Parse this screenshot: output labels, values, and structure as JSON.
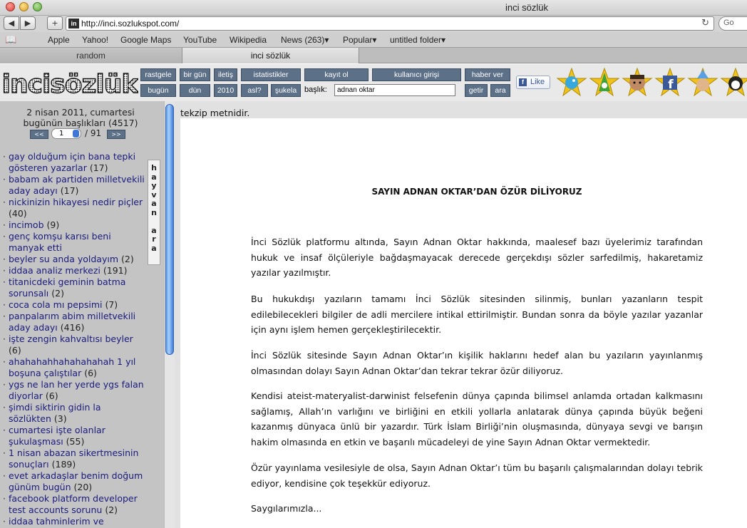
{
  "window": {
    "title": "inci sözlük"
  },
  "toolbar": {
    "back_icon": "back-arrow-icon",
    "forward_icon": "forward-arrow-icon",
    "add_icon": "plus-icon",
    "favicon_text": "in",
    "url": "http://inci.sozlukspot.com/",
    "reload_icon": "reload-icon",
    "search_placeholder": "Go"
  },
  "bookmarks": {
    "items": [
      "Apple",
      "Yahoo!",
      "Google Maps",
      "YouTube",
      "Wikipedia",
      "News (263)▾",
      "Popular▾",
      "untitled folder▾"
    ]
  },
  "tabs": [
    {
      "label": "random"
    },
    {
      "label": "inci sözlük"
    }
  ],
  "header": {
    "nav_row1": [
      "rastgele",
      "bir gün",
      "iletiş",
      "istatistikler",
      "kayıt ol",
      "kullanıcı girişi",
      "haber ver"
    ],
    "nav_row2": [
      "bugün",
      "dün",
      "2010",
      "asl?",
      "şukela",
      "getir",
      "ara"
    ],
    "baslik_label": "başlık:",
    "baslik_value": "adnan oktar",
    "like_label": "Like",
    "like_icon": "facebook-f-icon"
  },
  "left": {
    "date": "2 nisan 2011, cumartesi",
    "today_count": "bugünün başlıkları (4517)",
    "pager": {
      "prev": "<<",
      "next": ">>",
      "page": "1",
      "total": "/ 91"
    },
    "vertical_tab": [
      "h",
      "a",
      "y",
      "v",
      "a",
      "n",
      "",
      "a",
      "r",
      "a"
    ],
    "topics": [
      {
        "title": "gay olduğum için bana tepki gösteren yazarlar",
        "count": "(17)"
      },
      {
        "title": "babam ak partiden milletvekili aday adayı",
        "count": "(17)"
      },
      {
        "title": "nickinizin hikayesi nedir piçler",
        "count": "(40)"
      },
      {
        "title": "incimob",
        "count": "(9)"
      },
      {
        "title": "genç komşu karısı beni manyak etti",
        "count": ""
      },
      {
        "title": "beyler su anda yoldayım",
        "count": "(2)"
      },
      {
        "title": "iddaa analiz merkezi",
        "count": "(191)"
      },
      {
        "title": "titanicdeki geminin batma sorunsalı",
        "count": "(2)"
      },
      {
        "title": "coca cola mı pepsimi",
        "count": "(7)"
      },
      {
        "title": "panpalarım abim milletvekili aday adayı",
        "count": "(416)"
      },
      {
        "title": "işte zengin kahvaltısı beyler",
        "count": "(6)"
      },
      {
        "title": "ahahahahhahahahahah 1 yıl boşuna çalıştılar",
        "count": "(6)"
      },
      {
        "title": "ygs ne lan her yerde ygs falan diyorlar",
        "count": "(6)"
      },
      {
        "title": "şimdi siktirin gidin la sözlükten",
        "count": "(3)"
      },
      {
        "title": "cumartesi işte olanlar şukulaşması",
        "count": "(55)"
      },
      {
        "title": "1 nisan abazan sikertmesinin sonuçları",
        "count": "(189)"
      },
      {
        "title": "evet arkadaşlar benim doğum günüm bugün",
        "count": "(20)"
      },
      {
        "title": "facebook platform developer test accounts sorunu",
        "count": "(2)"
      },
      {
        "title": "iddaa tahminlerim ve",
        "count": ""
      }
    ]
  },
  "main": {
    "notice": "tekzip metnidir.",
    "title": "SAYIN ADNAN OKTAR’DAN ÖZÜR DİLİYORUZ",
    "paragraphs": [
      "İnci Sözlük platformu altında, Sayın Adnan Oktar hakkında, maalesef bazı üyelerimiz tarafından hukuk ve insaf ölçüleriyle bağdaşmayacak derecede gerçekdışı sözler sarfedilmiş, hakaretamiz yazılar yazılmıştır.",
      "Bu hukukdışı yazıların tamamı İnci Sözlük sitesinden silinmiş, bunları yazanların tespit edilebilecekleri bilgiler de adli mercilere intikal ettirilmiştir. Bundan sonra da böyle yazılar yazanlar için aynı işlem hemen gerçekleştirilecektir.",
      "İnci Sözlük sitesinde Sayın Adnan Oktar’ın kişilik haklarını hedef alan bu yazıların yayınlanmış olmasından dolayı Sayın Adnan Oktar’dan tekrar tekrar özür diliyoruz.",
      "Kendisi ateist-materyalist-darwinist felsefenin dünya çapında bilimsel anlamda ortadan kalkmasını sağlamış, Allah’ın varlığını ve birliğini en etkili yollarla anlatarak dünya çapında büyük beğeni kazanmış dünyaca ünlü bir yazardır. Türk İslam Birliği’nin oluşmasında, dünyaya sevgi ve barışın hakim olmasında en etkin ve başarılı mücadeleyi de yine Sayın Adnan Oktar vermektedir.",
      "Özür yayınlama vesilesiyle de olsa, Sayın Adnan Oktar’ı tüm bu başarılı çalışmalarından dolayı tebrik ediyor, kendisine çok teşekkür ediyoruz.",
      "Saygılarımızla..."
    ]
  },
  "colors": {
    "nav_button": "#5c7088",
    "topic_link": "#1a1a7e",
    "sidebar_bg": "#c4c4c4"
  }
}
